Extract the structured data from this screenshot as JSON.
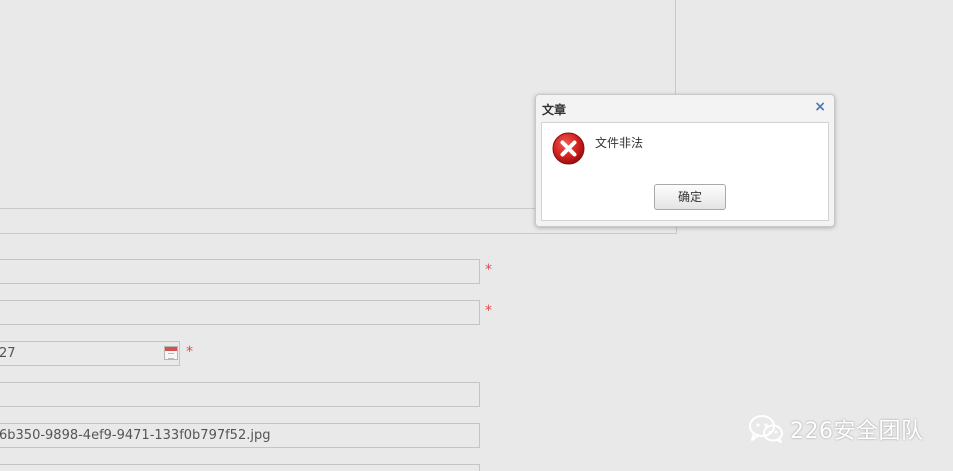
{
  "dialog": {
    "title": "文章",
    "close_label": "×",
    "icon": "error-icon",
    "message": "文件非法",
    "ok_label": "确定"
  },
  "form": {
    "fields": [
      {
        "value": "",
        "required": true
      },
      {
        "value": "",
        "required": true
      },
      {
        "value": "27",
        "required": true,
        "has_calendar": true
      },
      {
        "value": "",
        "required": false
      },
      {
        "value": "6b350-9898-4ef9-9471-133f0b797f52.jpg",
        "required": false
      },
      {
        "value": "",
        "required": false
      }
    ],
    "required_mark": "*"
  },
  "watermark": {
    "text": "226安全团队",
    "icon": "wechat-icon"
  },
  "colors": {
    "background": "#e9e9e9",
    "required": "#e04848",
    "error_red": "#d0211f",
    "close_blue": "#4a78b5"
  }
}
